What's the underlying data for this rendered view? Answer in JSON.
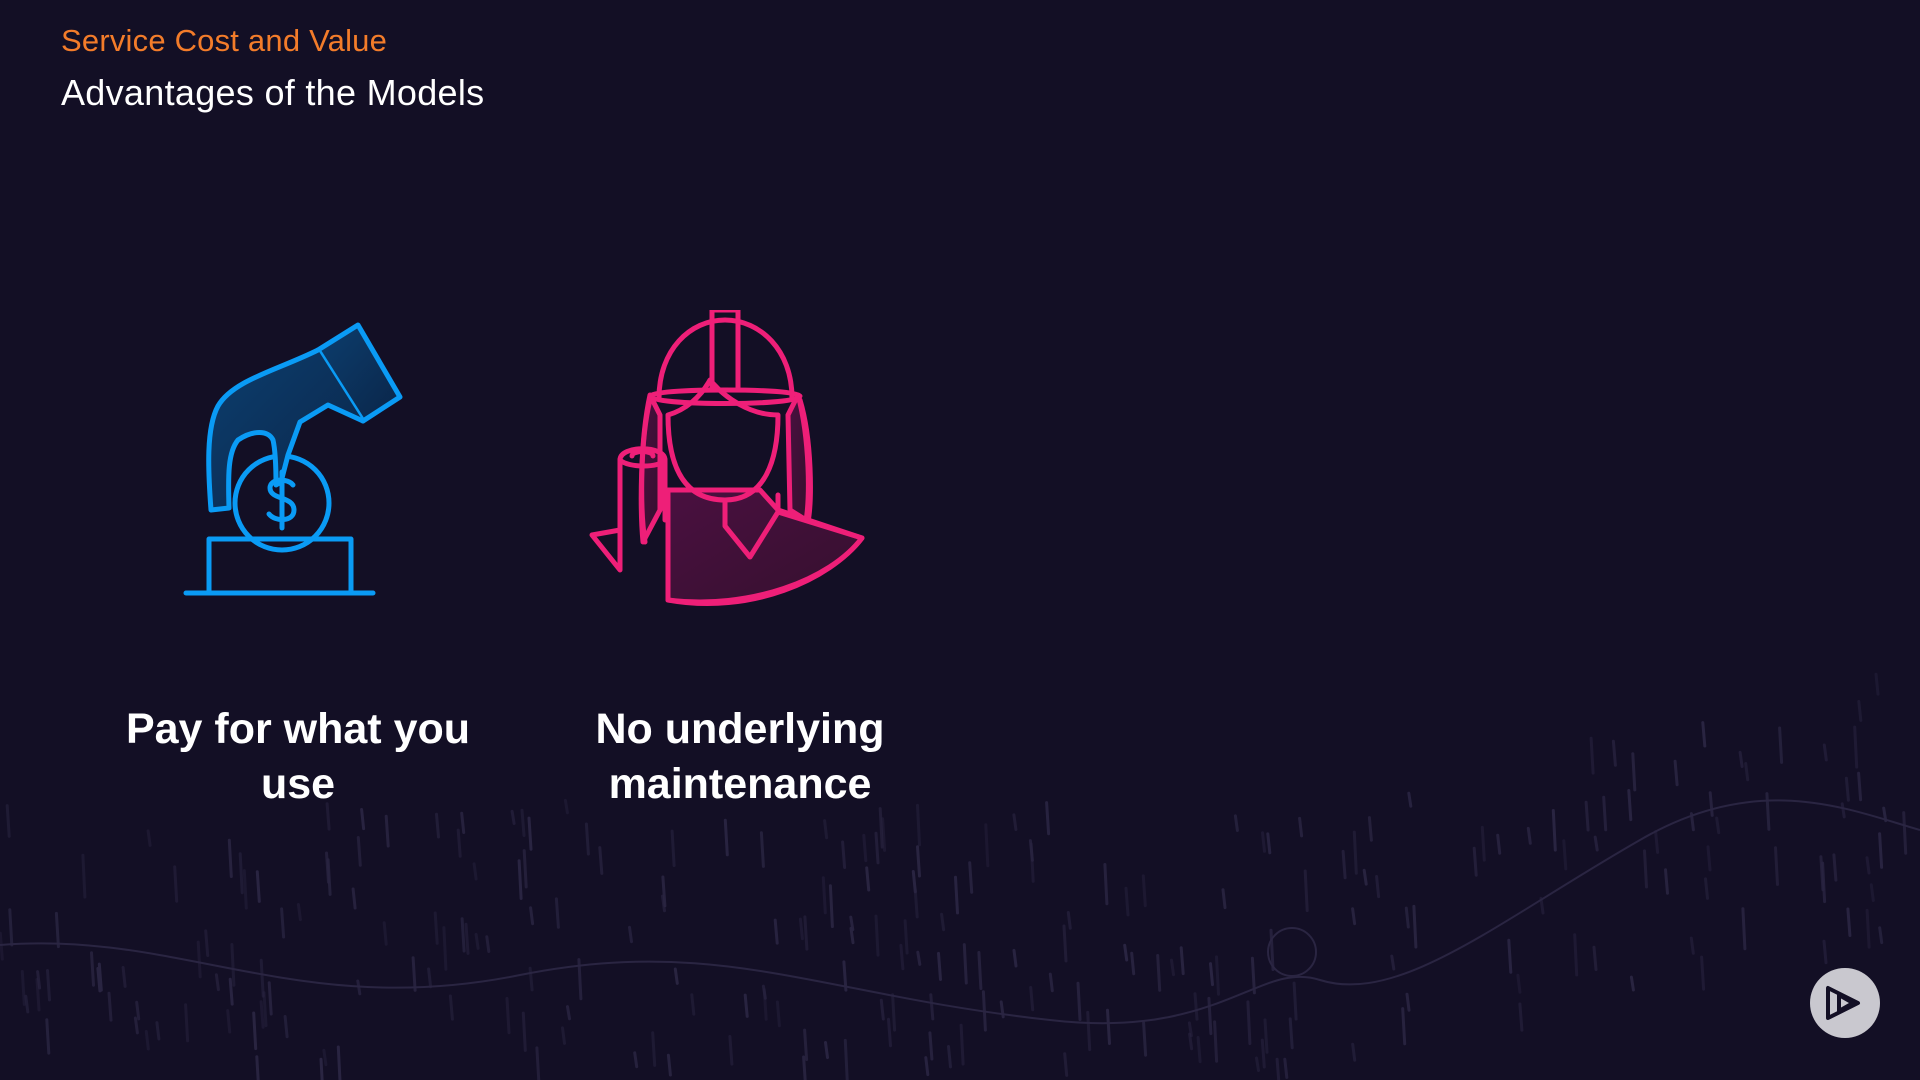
{
  "header": {
    "eyebrow": "Service Cost and Value",
    "title": "Advantages of the Models"
  },
  "cards": [
    {
      "icon": "hand-coin-dollar-icon",
      "caption_line1": "Pay for what you",
      "caption_line2": "use"
    },
    {
      "icon": "engineer-hardhat-icon",
      "caption_line1": "No underlying",
      "caption_line2": "maintenance"
    }
  ],
  "branding": {
    "logo": "play-logo-icon"
  },
  "colors": {
    "background": "#130f25",
    "eyebrow": "#f37c2a",
    "title": "#ffffff",
    "caption": "#ffffff",
    "icon_blue": "#0a9bf5",
    "icon_pink": "#ee1f78",
    "logo": "#c9c8cf"
  }
}
